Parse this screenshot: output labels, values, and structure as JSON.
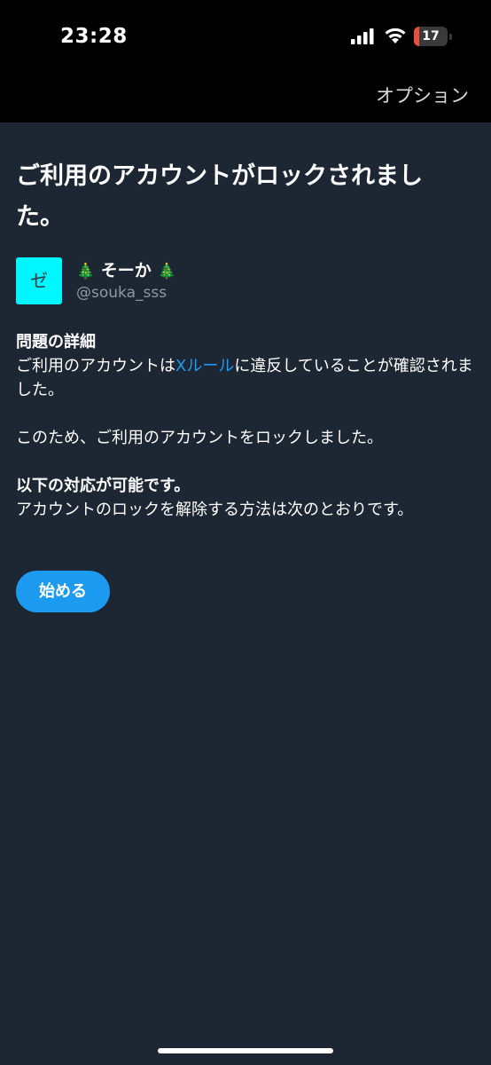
{
  "status_bar": {
    "time": "23:28",
    "battery_level": "17",
    "battery_fraction": 0.17,
    "signal_icon": "cellular-signal-icon",
    "wifi_icon": "wifi-icon",
    "battery_icon": "battery-icon"
  },
  "nav": {
    "options_label": "オプション"
  },
  "page": {
    "title": "ご利用のアカウントがロックされました。"
  },
  "account": {
    "display_name_text": "そーか",
    "tree_emoji": "🎄",
    "handle": "@souka_sss",
    "avatar_color": "#00f7ff",
    "avatar_glyph": "ゼ"
  },
  "details": {
    "heading": "問題の詳細",
    "text_before_link": "ご利用のアカウントは",
    "link_text": "Xルール",
    "text_after_link": "に違反していることが確認されました。",
    "lock_notice": "このため、ご利用のアカウントをロックしました。"
  },
  "actions": {
    "heading": "以下の対応が可能です。",
    "description": "アカウントのロックを解除する方法は次のとおりです。",
    "start_button_label": "始める"
  },
  "colors": {
    "background": "#1d2733",
    "accent": "#1d9bf0",
    "battery_low": "#eb4e3d"
  }
}
